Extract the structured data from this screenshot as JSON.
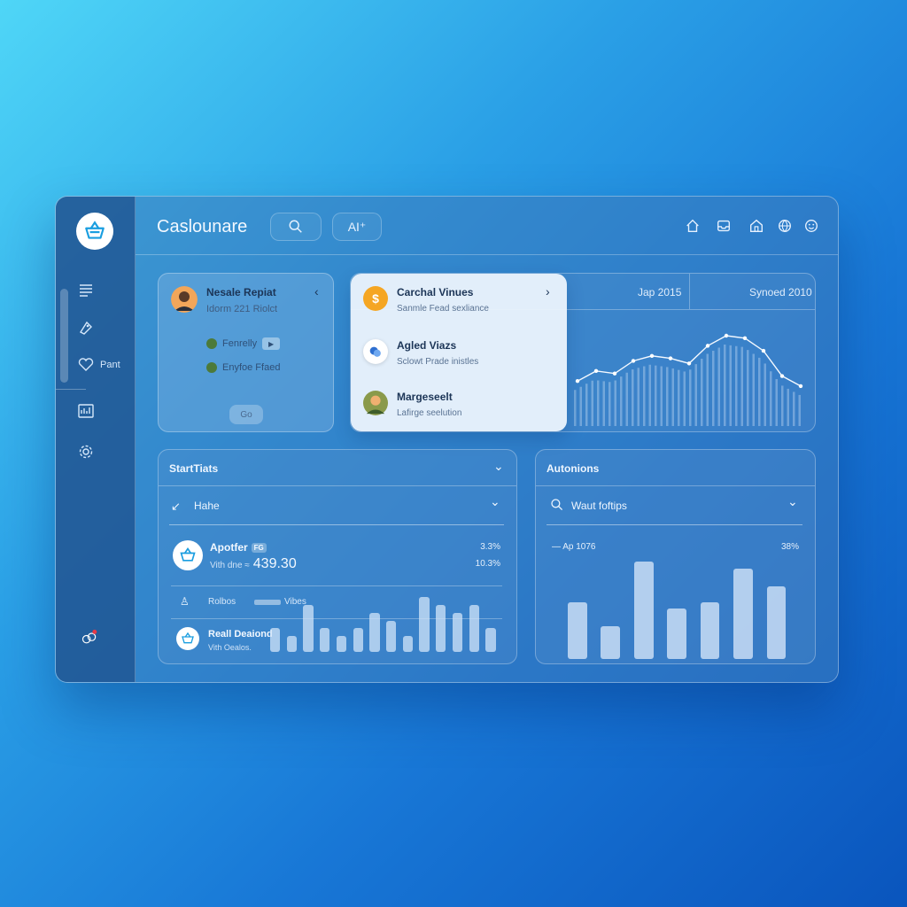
{
  "app": {
    "title": "Caslounare"
  },
  "topbar": {
    "search_button": "",
    "ai_button": "AI⁺"
  },
  "sidebar": {
    "items": [
      {
        "label": ""
      },
      {
        "label": ""
      },
      {
        "label": "Pant"
      },
      {
        "label": ""
      },
      {
        "label": ""
      }
    ]
  },
  "card_profile": {
    "title": "Nesale Repiat",
    "subtitle": "Idorm 221 Riolct",
    "rows": [
      {
        "label": "Fenrelly"
      },
      {
        "label": "Enyfoe Ffaed"
      }
    ],
    "button": "Go"
  },
  "card_list": {
    "items": [
      {
        "title": "Carchal Vinues",
        "sub": "Sanmle Fead sexliance"
      },
      {
        "title": "Agled Viazs",
        "sub": "Sclowt Prade inistles"
      },
      {
        "title": "Margeseelt",
        "sub": "Lafirge seelution"
      }
    ]
  },
  "line_card": {
    "headers": [
      "Jap 2015",
      "Synoed 2010"
    ],
    "line_values": [
      8,
      12,
      11,
      16,
      18,
      17,
      15,
      22,
      26,
      25,
      20,
      10,
      6
    ]
  },
  "stats_card": {
    "title": "StartTiats",
    "filter_label": "Hahe",
    "row1": {
      "title": "Apotfer",
      "badge": "FG",
      "sub": "Vith dne ≈",
      "value": "439.30",
      "r1": "3.3%",
      "r2": "10.3%"
    },
    "row2": {
      "label": "Rolbos",
      "tag": "Vibes"
    },
    "row3": {
      "title": "Reall Deaiond",
      "sub": "Vith Oealos."
    },
    "bar_values": [
      3,
      2,
      6,
      3,
      2,
      3,
      5,
      4,
      2,
      7,
      6,
      5,
      6,
      3
    ]
  },
  "autonions_card": {
    "title": "Autonions",
    "search_label": "Waut foftips",
    "legend": "Ap 1076",
    "percent": "38%",
    "bar_values": [
      58,
      34,
      100,
      52,
      58,
      93,
      75
    ]
  },
  "colors": {
    "accent": "#2a9fe6",
    "orange": "#f5a623",
    "brand": "#1a8fd8"
  }
}
